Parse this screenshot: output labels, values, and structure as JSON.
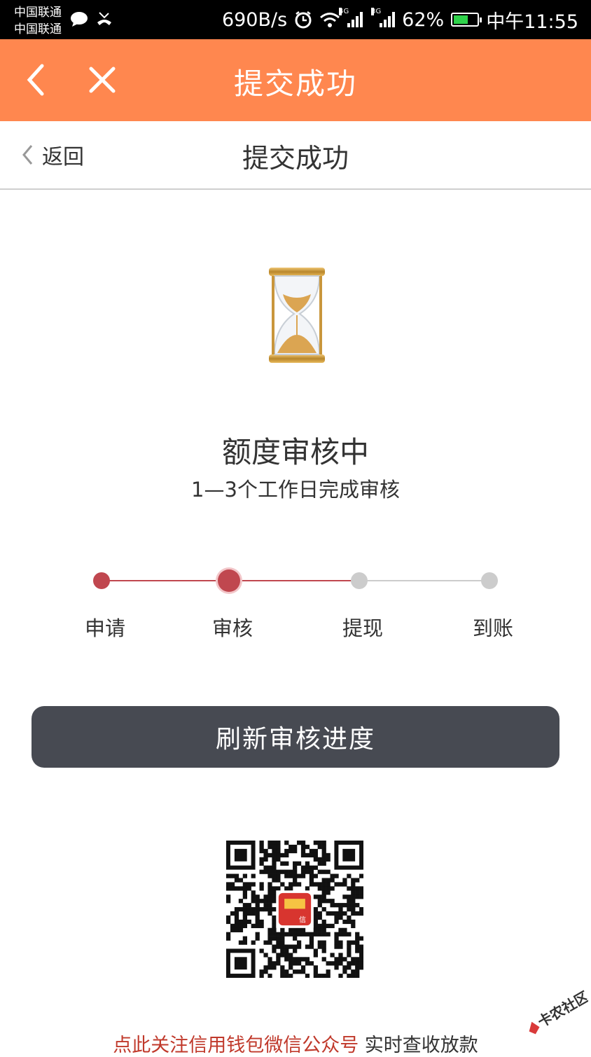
{
  "status_bar": {
    "carrier1": "中国联通",
    "carrier2": "中国联通",
    "speed": "690B/s",
    "net1": "4G",
    "net2": "3G",
    "battery": "62%",
    "battery_level": 0.62,
    "time": "中午11:55"
  },
  "topbar": {
    "title": "提交成功",
    "back_icon": "chevron-left-icon",
    "close_icon": "close-icon"
  },
  "subheader": {
    "back_label": "返回",
    "title": "提交成功"
  },
  "status": {
    "title": "额度审核中",
    "subtitle": "1—3个工作日完成审核"
  },
  "steps": [
    {
      "label": "申请",
      "state": "done"
    },
    {
      "label": "审核",
      "state": "current"
    },
    {
      "label": "提现",
      "state": "pending"
    },
    {
      "label": "到账",
      "state": "pending"
    }
  ],
  "colors": {
    "accent": "#ff874f",
    "step_active": "#c0474f",
    "step_inactive": "#cccccc",
    "button": "#474a52",
    "link": "#c0392b"
  },
  "refresh_button": "刷新审核进度",
  "qr_logo_char": "信",
  "footer": {
    "link_text": "点此关注信用钱包微信公众号",
    "rest_text": " 实时查收放款"
  },
  "watermark": "卡农社区"
}
